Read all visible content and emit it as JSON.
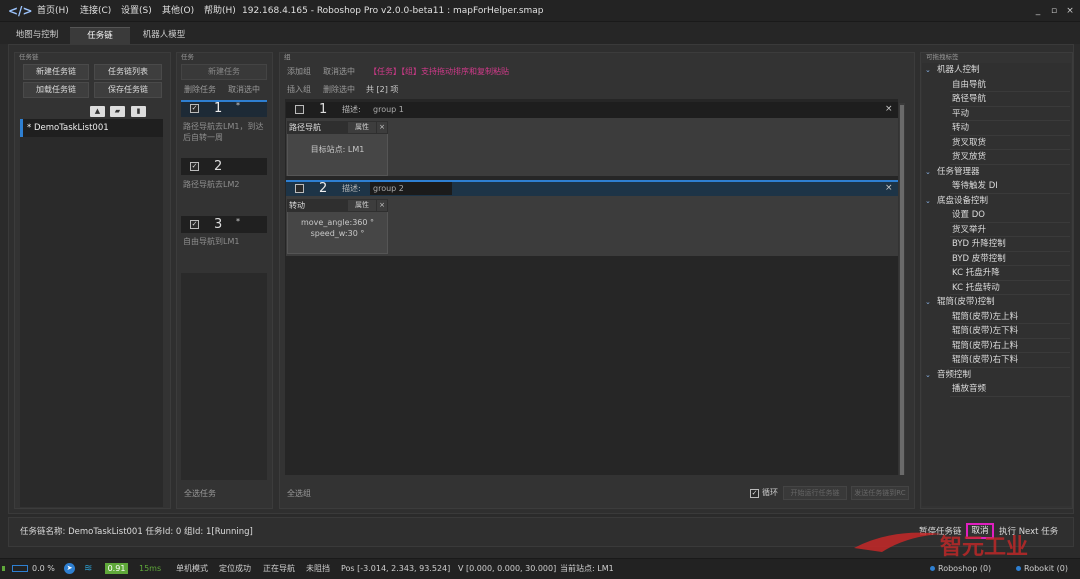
{
  "menu": {
    "home": "首页(H)",
    "connect": "连接(C)",
    "settings": "设置(S)",
    "other": "其他(O)",
    "help": "帮助(H)"
  },
  "window": {
    "title": "192.168.4.165 - Roboshop Pro v2.0.0-beta11 : mapForHelper.smap",
    "minimize": "_",
    "maximize": "▫",
    "close": "×"
  },
  "tabs": [
    "地图与控制",
    "任务链",
    "机器人模型"
  ],
  "taskchain_panel": {
    "title": "任务链",
    "new_btn": "新建任务链",
    "list_btn": "任务链列表",
    "load_btn": "加载任务链",
    "save_btn": "保存任务链",
    "items": [
      "* DemoTaskList001"
    ]
  },
  "task_panel": {
    "title": "任务",
    "new_task": "新建任务",
    "delete_task": "删除任务",
    "cancel_select": "取消选中",
    "select_all": "全选任务",
    "tasks": [
      {
        "num": "1",
        "mark": "*",
        "desc": "路径导航去LM1，到达后自转一周"
      },
      {
        "num": "2",
        "mark": "",
        "desc": "路径导航去LM2"
      },
      {
        "num": "3",
        "mark": "*",
        "desc": "自由导航到LM1"
      }
    ]
  },
  "group_panel": {
    "title": "组",
    "add_group": "添加组",
    "cancel_select": "取消选中",
    "hint": "【任务】【组】支持拖动排序和复制粘贴",
    "insert_group": "插入组",
    "delete_select": "删除选中",
    "total": "共 [2] 项",
    "desc_label": "描述:",
    "select_all": "全选组",
    "loop_label": "循环",
    "start_btn": "开始运行任务链",
    "stop_btn": "发送任务链到RC",
    "groups": [
      {
        "num": "1",
        "desc": "group 1",
        "action": "路径导航",
        "prop": "属性",
        "params": [
          "目标站点:  LM1"
        ]
      },
      {
        "num": "2",
        "desc": "group 2",
        "action": "转动",
        "prop": "属性",
        "params": [
          "move_angle:360 °",
          "speed_w:30 °"
        ]
      }
    ]
  },
  "drag_panel": {
    "title": "可拖拽标签",
    "categories": [
      {
        "name": "机器人控制",
        "items": [
          "自由导航",
          "路径导航",
          "平动",
          "转动",
          "货叉取货",
          "货叉放货"
        ]
      },
      {
        "name": "任务管理器",
        "items": [
          "等待触发 DI"
        ]
      },
      {
        "name": "底盘设备控制",
        "items": [
          "设置 DO",
          "货叉举升",
          "BYD 升降控制",
          "BYD 皮带控制",
          "KC 托盘升降",
          "KC 托盘转动"
        ]
      },
      {
        "name": "辊筒(皮带)控制",
        "items": [
          "辊筒(皮带)左上料",
          "辊筒(皮带)左下料",
          "辊筒(皮带)右上料",
          "辊筒(皮带)右下料"
        ]
      },
      {
        "name": "音频控制",
        "items": [
          "播放音频"
        ]
      }
    ]
  },
  "bottom_bar": {
    "status": "任务链名称:  DemoTaskList001  任务Id: 0  组Id: 1[Running]",
    "pause": "暂停任务链",
    "cancel": "取消",
    "next": "执行 Next 任务"
  },
  "statusbar": {
    "battery": "0.0 %",
    "voltage": "0.91",
    "latency": "15ms",
    "mode": "单机模式",
    "locate": "定位成功",
    "nav": "正在导航",
    "block": "未阻挡",
    "pos": "Pos [-3.014, 2.343, 93.524]",
    "vel": "V [0.000, 0.000, 30.000]",
    "station": "当前站点:  LM1",
    "roboshop": "Roboshop (0)",
    "robokit": "Robokit (0)"
  },
  "watermark": "智元工业",
  "colors": {
    "accent": "#2e7fd1",
    "hint": "#d03a8a",
    "highlight": "#e020c0",
    "voltage_bg": "#5fa83a"
  }
}
